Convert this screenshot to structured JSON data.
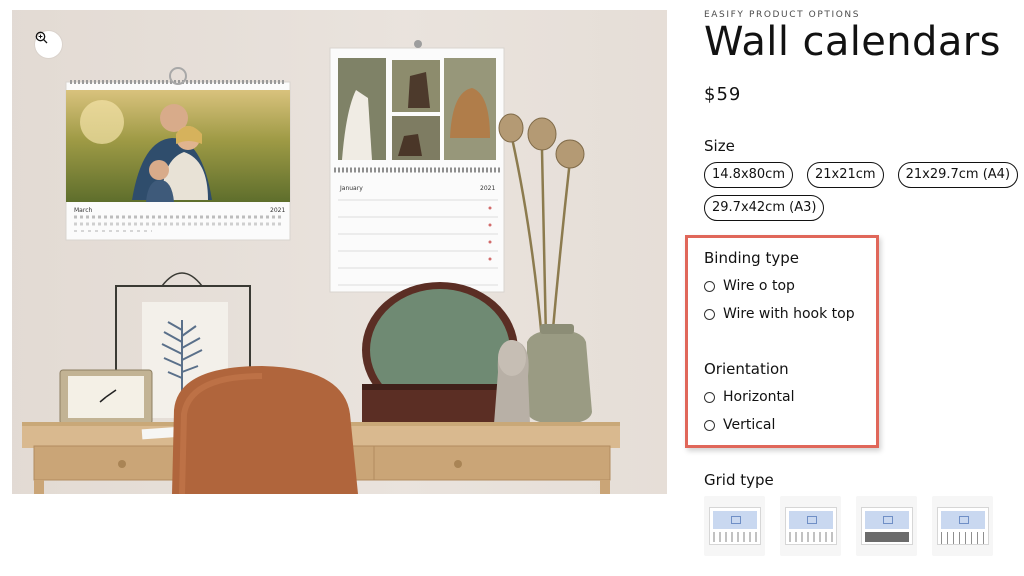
{
  "product": {
    "vendor": "EASIFY PRODUCT OPTIONS",
    "title": "Wall calendars",
    "price": "$59"
  },
  "options": {
    "size": {
      "label": "Size",
      "values": [
        "14.8x80cm",
        "21x21cm",
        "21x29.7cm (A4)",
        "29.7x42cm (A3)"
      ]
    },
    "binding_type": {
      "label": "Binding type",
      "values": [
        "Wire o top",
        "Wire with hook top"
      ]
    },
    "orientation": {
      "label": "Orientation",
      "values": [
        "Horizontal",
        "Vertical"
      ]
    },
    "grid_type": {
      "label": "Grid type"
    }
  },
  "photo": {
    "cal1_month": "March",
    "cal1_year": "2021",
    "cal2_month": "January",
    "cal2_year": "2021"
  },
  "colors": {
    "highlight_border": "#e0675a",
    "text": "#121212",
    "wall": "#e9e2dc",
    "desk": "#d9b98f"
  },
  "icons": [
    "zoom-icon",
    "radio-circle-icon"
  ]
}
